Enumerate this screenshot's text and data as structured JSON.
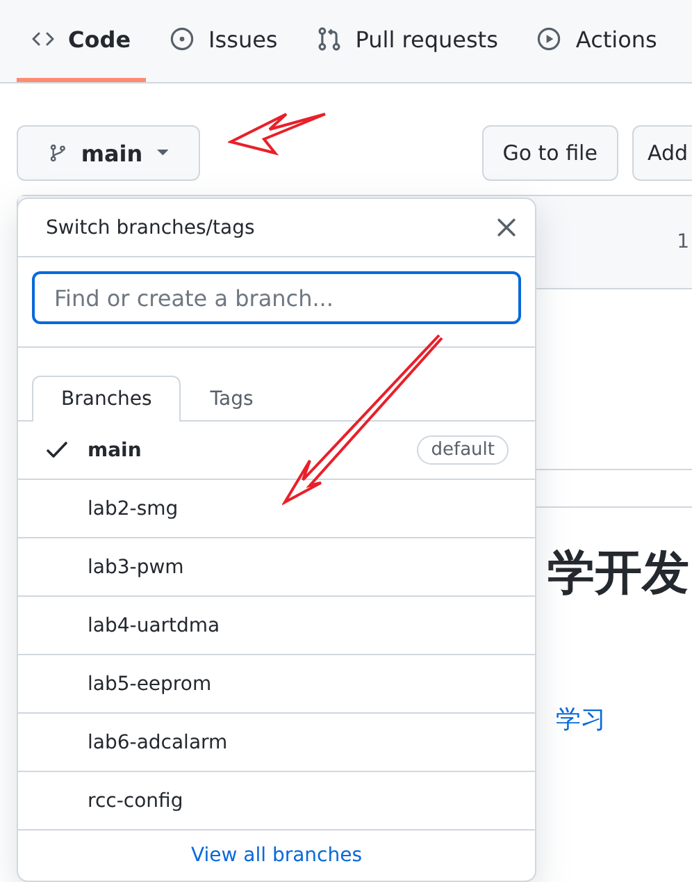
{
  "tabs": [
    {
      "label": "Code",
      "kind": "code",
      "selected": true
    },
    {
      "label": "Issues",
      "kind": "issues",
      "selected": false
    },
    {
      "label": "Pull requests",
      "kind": "pulls",
      "selected": false
    },
    {
      "label": "Actions",
      "kind": "actions",
      "selected": false
    }
  ],
  "branch_button": {
    "label": "main"
  },
  "buttons": [
    "Go to file",
    "Add"
  ],
  "background": {
    "count": "1",
    "heading": "学开发",
    "link": "学习"
  },
  "dropdown": {
    "title": "Switch branches/tags",
    "search": {
      "placeholder": "Find or create a branch..."
    },
    "tabs": [
      {
        "label": "Branches",
        "selected": true
      },
      {
        "label": "Tags",
        "selected": false
      }
    ],
    "branches": [
      {
        "name": "main",
        "selected": true,
        "badge": "default"
      },
      {
        "name": "lab2-smg",
        "selected": false
      },
      {
        "name": "lab3-pwm",
        "selected": false
      },
      {
        "name": "lab4-uartdma",
        "selected": false
      },
      {
        "name": "lab5-eeprom",
        "selected": false
      },
      {
        "name": "lab6-adcalarm",
        "selected": false
      },
      {
        "name": "rcc-config",
        "selected": false
      }
    ],
    "footer_link": "View all branches"
  }
}
